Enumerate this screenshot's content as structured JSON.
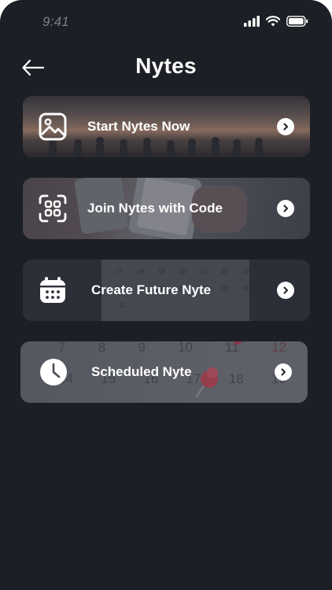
{
  "status_bar": {
    "time": "9:41",
    "icons": [
      "signal-icon",
      "wifi-icon",
      "battery-icon"
    ]
  },
  "header": {
    "title": "Nytes",
    "back_icon": "arrow-left-icon"
  },
  "cards": [
    {
      "label": "Start Nytes Now",
      "icon": "image-icon",
      "chevron": "chevron-right-icon"
    },
    {
      "label": "Join Nytes with Code",
      "icon": "qr-scan-icon",
      "chevron": "chevron-right-icon"
    },
    {
      "label": "Create Future Nyte",
      "icon": "calendar-icon",
      "chevron": "chevron-right-icon"
    },
    {
      "label": "Scheduled Nyte",
      "icon": "clock-icon",
      "chevron": "chevron-right-icon"
    }
  ],
  "calendar_small_rows": [
    [
      "17",
      "18",
      "19",
      "20",
      "21",
      "22",
      "23"
    ],
    [
      "24",
      "25",
      "26",
      "27",
      "28",
      "29",
      "30"
    ],
    [
      "31"
    ]
  ],
  "calendar_large_rows": [
    [
      "7",
      "8",
      "9",
      "10",
      "11",
      "12"
    ],
    [
      "14",
      "15",
      "16",
      "17",
      "18",
      "19"
    ]
  ],
  "colors": {
    "background": "#1c1f25",
    "text": "#ffffff",
    "muted": "#7d8088"
  }
}
